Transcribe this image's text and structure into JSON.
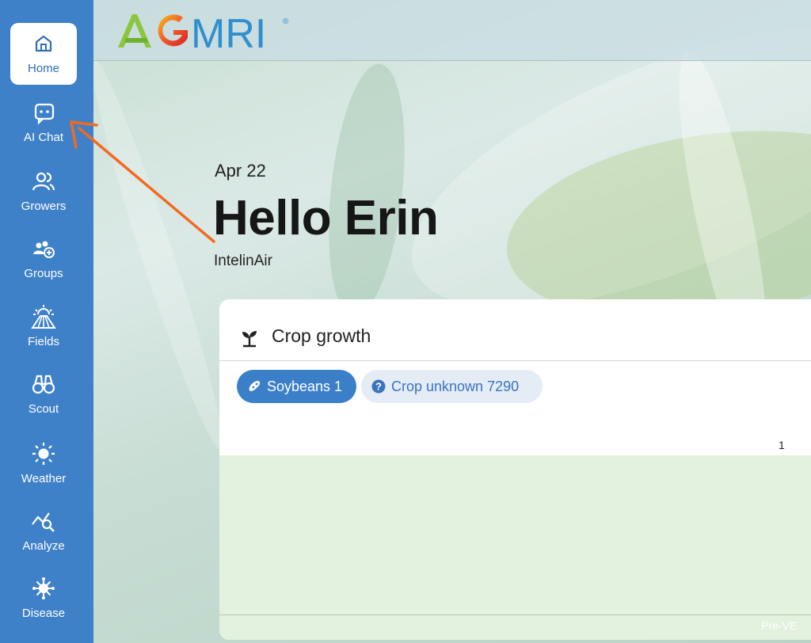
{
  "brand": {
    "logo_text_ag": "AG",
    "logo_text_mri": "MRI",
    "registered": "®"
  },
  "sidebar": {
    "items": [
      {
        "label": "Home",
        "icon": "home-icon",
        "active": true
      },
      {
        "label": "AI Chat",
        "icon": "chat-icon",
        "active": false
      },
      {
        "label": "Growers",
        "icon": "growers-icon",
        "active": false
      },
      {
        "label": "Groups",
        "icon": "groups-icon",
        "active": false
      },
      {
        "label": "Fields",
        "icon": "fields-icon",
        "active": false
      },
      {
        "label": "Scout",
        "icon": "binoculars-icon",
        "active": false
      },
      {
        "label": "Weather",
        "icon": "sun-icon",
        "active": false
      },
      {
        "label": "Analyze",
        "icon": "analyze-icon",
        "active": false
      },
      {
        "label": "Disease",
        "icon": "disease-icon",
        "active": false
      }
    ]
  },
  "greeting": {
    "date": "Apr 22",
    "hello": "Hello Erin",
    "organization": "IntelinAir"
  },
  "crop_growth": {
    "title": "Crop growth",
    "chips": [
      {
        "label": "Soybeans 1",
        "selected": true,
        "icon": "soybean-icon"
      },
      {
        "label": "Crop unknown 7290",
        "selected": false,
        "icon": "question-icon"
      }
    ],
    "axis_tick": "1",
    "stage_label": "Pre-VE"
  },
  "colors": {
    "sidebar": "#3f81c9",
    "accent": "#3b7fc9",
    "annotation_arrow": "#f26a21",
    "plot_fill": "#e3f1df"
  }
}
